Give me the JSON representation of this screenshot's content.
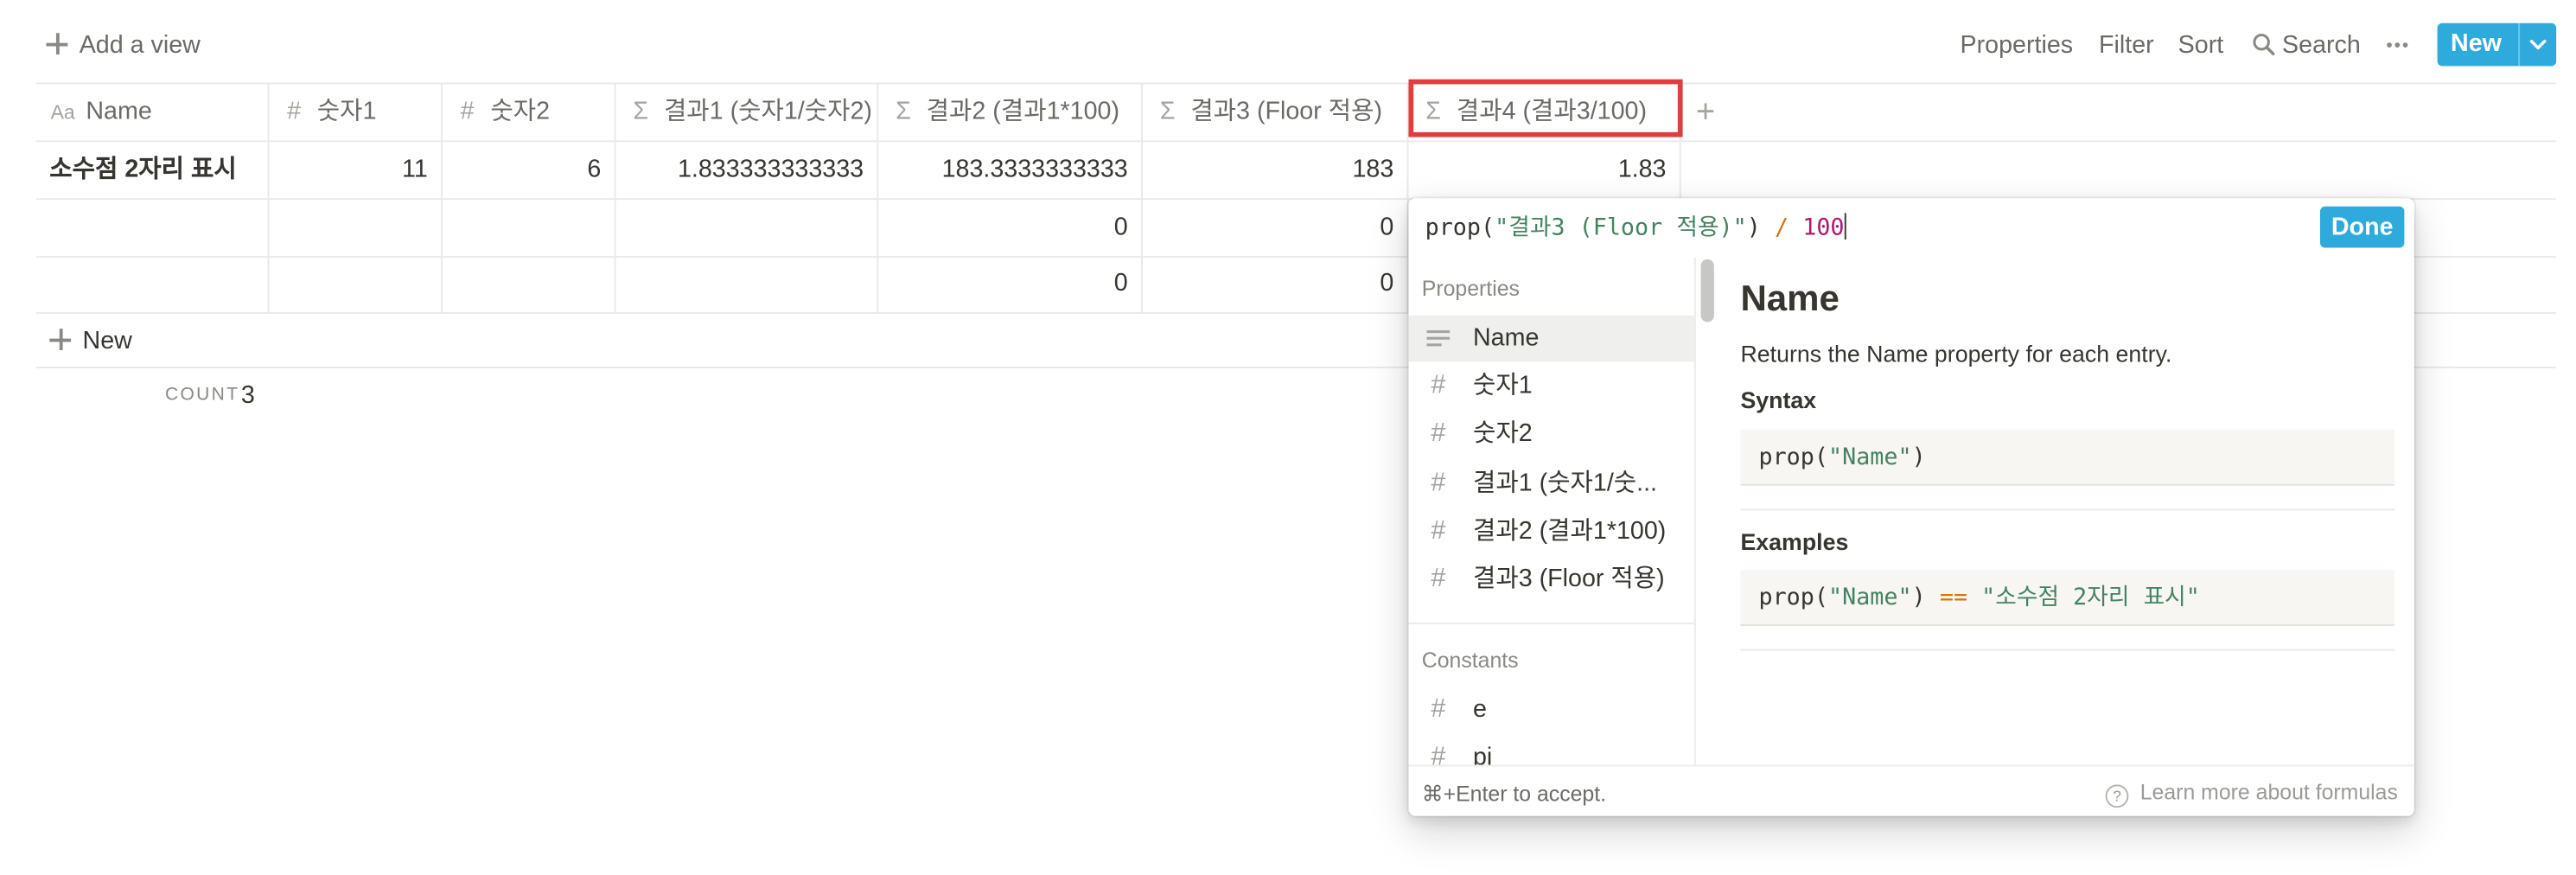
{
  "toolbar": {
    "add_view": "Add a view",
    "properties": "Properties",
    "filter": "Filter",
    "sort": "Sort",
    "search": "Search",
    "more": "•••",
    "new_label": "New"
  },
  "table": {
    "add_column": "+",
    "columns": [
      {
        "icon": "Aa",
        "label": "Name"
      },
      {
        "icon": "#",
        "label": "숫자1"
      },
      {
        "icon": "#",
        "label": "숫자2"
      },
      {
        "icon": "Σ",
        "label": "결과1 (숫자1/숫자2)"
      },
      {
        "icon": "Σ",
        "label": "결과2 (결과1*100)"
      },
      {
        "icon": "Σ",
        "label": "결과3 (Floor 적용)"
      },
      {
        "icon": "Σ",
        "label": "결과4 (결과3/100)"
      }
    ],
    "rows": [
      [
        "소수점 2자리 표시",
        "11",
        "6",
        "1.833333333333",
        "183.3333333333",
        "183",
        "1.83"
      ],
      [
        "",
        "",
        "",
        "",
        "0",
        "0",
        ""
      ],
      [
        "",
        "",
        "",
        "",
        "0",
        "0",
        ""
      ]
    ],
    "new_row": "New",
    "count_label": "COUNT",
    "count_value": "3"
  },
  "formula_editor": {
    "fn": "prop(",
    "arg": "\"결과3 (Floor 적용)\"",
    "close": ")",
    "op": " / ",
    "num": "100",
    "done": "Done",
    "sections": {
      "properties": "Properties",
      "constants": "Constants"
    },
    "properties": [
      {
        "icon": "text-lines-icon",
        "label": "Name"
      },
      {
        "icon": "#",
        "label": "숫자1"
      },
      {
        "icon": "#",
        "label": "숫자2"
      },
      {
        "icon": "#",
        "label": "결과1 (숫자1/숫..."
      },
      {
        "icon": "#",
        "label": "결과2 (결과1*100)"
      },
      {
        "icon": "#",
        "label": "결과3 (Floor 적용)"
      }
    ],
    "constants": [
      {
        "icon": "#",
        "label": "e"
      },
      {
        "icon": "#",
        "label": "pi"
      }
    ],
    "doc": {
      "title": "Name",
      "desc": "Returns the Name property for each entry.",
      "syntax_label": "Syntax",
      "syntax_fn": "prop(",
      "syntax_arg": "\"Name\"",
      "syntax_close": ")",
      "examples_label": "Examples",
      "ex_fn": "prop(",
      "ex_arg": "\"Name\"",
      "ex_close": ")",
      "ex_op": " == ",
      "ex_value": "\"소수점 2자리 표시\""
    },
    "footer_hint": "⌘+Enter to accept.",
    "learn_more": "Learn more about formulas"
  },
  "colors": {
    "accent": "#2eaadc",
    "highlight_border": "#e03e3e",
    "string": "#448361",
    "operator": "#d9730d",
    "number": "#ad1a72"
  }
}
